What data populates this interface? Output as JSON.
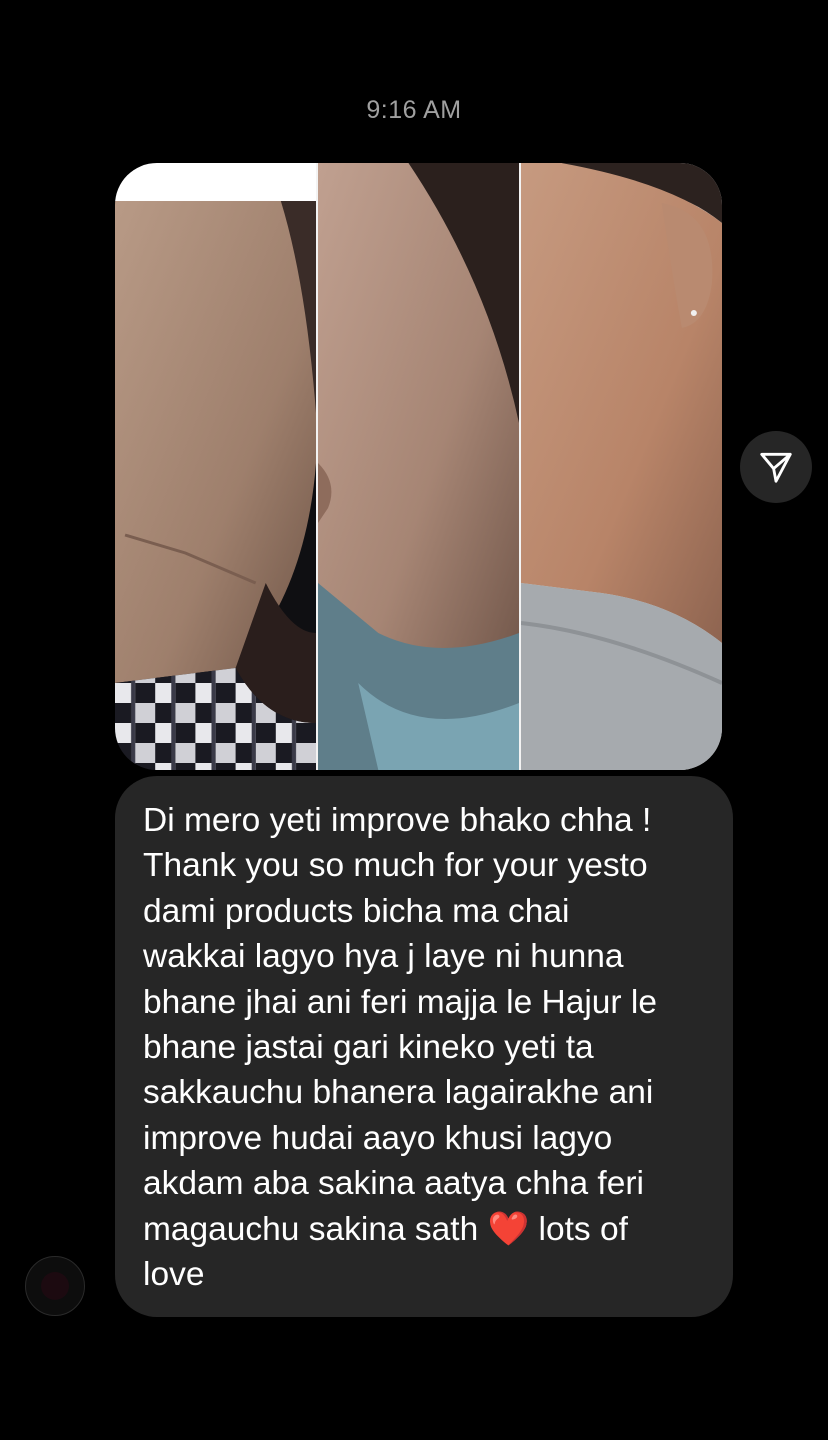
{
  "message": {
    "timestamp": "9:16 AM",
    "text": "Di mero yeti improve bhako chha !\nThank you so much for your yesto\ndami products bicha ma chai\nwakkai lagyo hya j laye ni hunna\nbhane jhai ani feri majja le Hajur le\nbhane jastai gari kineko yeti ta\nsakkauchu bhanera lagairakhe ani\nimprove hudai aayo khusi lagyo\nakdam aba sakina aatya chha feri\nmagauchu  sakina sath ❤️  lots of\nlove"
  },
  "icons": {
    "share": "paper-plane-icon",
    "avatar": "user-avatar"
  },
  "colors": {
    "background": "#000000",
    "bubble": "#262626",
    "timestamp": "#a0a0a0",
    "text": "#ffffff"
  }
}
